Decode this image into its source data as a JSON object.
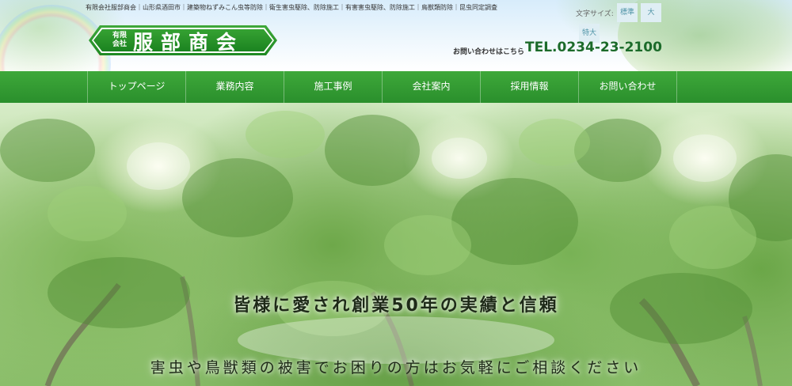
{
  "header": {
    "tagline": "有限会社服部商会｜山形県酒田市｜建築物ねずみこん虫等防除｜衛生害虫駆除、防除施工｜有害害虫駆除、防除施工｜鳥獣類防除｜昆虫同定調査",
    "logo": {
      "small_line1": "有限",
      "small_line2": "会社",
      "main": "服部商会"
    },
    "font_size": {
      "label": "文字サイズ:",
      "options": [
        "標準",
        "大",
        "特大"
      ]
    },
    "contact": {
      "label": "お問い合わせはこちら",
      "tel": "TEL.0234-23-2100"
    }
  },
  "nav": {
    "items": [
      "トップページ",
      "業務内容",
      "施工事例",
      "会社案内",
      "採用情報",
      "お問い合わせ"
    ]
  },
  "hero": {
    "title": "皆様に愛され創業50年の実績と信頼",
    "subtitle": "害虫や鳥獣類の被害でお困りの方はお気軽にご相談ください"
  },
  "colors": {
    "nav_green": "#2e952f",
    "logo_green": "#2a962a",
    "tel_green": "#1c6b2a",
    "font_button_bg": "#dfeef4",
    "font_button_text": "#4e93a6"
  }
}
